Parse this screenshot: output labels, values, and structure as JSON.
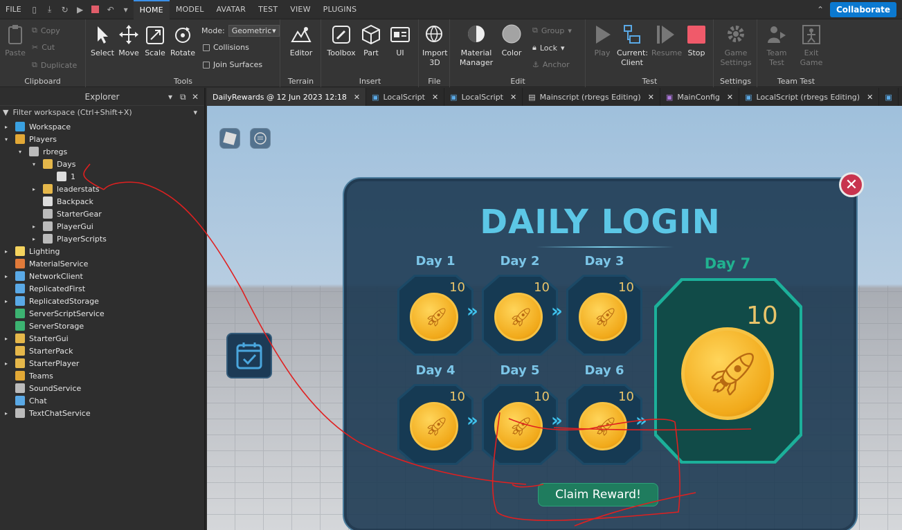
{
  "menubar": {
    "file": "FILE",
    "tabs": [
      "HOME",
      "MODEL",
      "AVATAR",
      "TEST",
      "VIEW",
      "PLUGINS"
    ],
    "active_tab": "HOME",
    "collaborate": "Collaborate"
  },
  "ribbon": {
    "clipboard": {
      "paste": "Paste",
      "copy": "Copy",
      "cut": "Cut",
      "duplicate": "Duplicate",
      "label": "Clipboard"
    },
    "tools": {
      "select": "Select",
      "move": "Move",
      "scale": "Scale",
      "rotate": "Rotate",
      "mode_label": "Mode:",
      "mode_value": "Geometric",
      "collisions": "Collisions",
      "join_surfaces": "Join Surfaces",
      "label": "Tools"
    },
    "terrain": {
      "editor": "Editor",
      "label": "Terrain"
    },
    "insert": {
      "toolbox": "Toolbox",
      "part": "Part",
      "ui": "UI",
      "label": "Insert"
    },
    "file": {
      "import": "Import",
      "import2": "3D",
      "label": "File"
    },
    "edit": {
      "material": "Material",
      "material2": "Manager",
      "color": "Color",
      "group": "Group",
      "lock": "Lock",
      "anchor": "Anchor",
      "label": "Edit"
    },
    "test": {
      "play": "Play",
      "current": "Current:",
      "client": "Client",
      "resume": "Resume",
      "stop": "Stop",
      "label": "Test"
    },
    "settings": {
      "game": "Game",
      "game2": "Settings",
      "label": "Settings"
    },
    "teamtest": {
      "team": "Team",
      "team2": "Test",
      "exit": "Exit",
      "exit2": "Game",
      "label": "Team Test"
    }
  },
  "explorer": {
    "title": "Explorer",
    "filter": "Filter workspace (Ctrl+Shift+X)",
    "items": [
      "Workspace",
      "Players",
      "rbregs",
      "Days",
      "1",
      "leaderstats",
      "Backpack",
      "StarterGear",
      "PlayerGui",
      "PlayerScripts",
      "Lighting",
      "MaterialService",
      "NetworkClient",
      "ReplicatedFirst",
      "ReplicatedStorage",
      "ServerScriptService",
      "ServerStorage",
      "StarterGui",
      "StarterPack",
      "StarterPlayer",
      "Teams",
      "SoundService",
      "Chat",
      "TextChatService"
    ]
  },
  "doc_tabs": [
    "DailyRewards @ 12 Jun 2023 12:18",
    "LocalScript",
    "LocalScript",
    "Mainscript (rbregs Editing)",
    "MainConfig",
    "LocalScript (rbregs Editing)"
  ],
  "daily": {
    "title": "DAILY LOGIN",
    "days": [
      {
        "label": "Day 1",
        "amount": "10"
      },
      {
        "label": "Day 2",
        "amount": "10"
      },
      {
        "label": "Day 3",
        "amount": "10"
      },
      {
        "label": "Day 4",
        "amount": "10"
      },
      {
        "label": "Day 5",
        "amount": "10"
      },
      {
        "label": "Day 6",
        "amount": "10"
      }
    ],
    "big": {
      "label": "Day 7",
      "amount": "10"
    },
    "claim": "Claim Reward!"
  },
  "colors": {
    "accent": "#0b79d0",
    "title": "#5cc7e6",
    "coin": "#f1a91a",
    "claim": "#1f7c5e",
    "close": "#c8344e",
    "annotation": "#e02020"
  }
}
